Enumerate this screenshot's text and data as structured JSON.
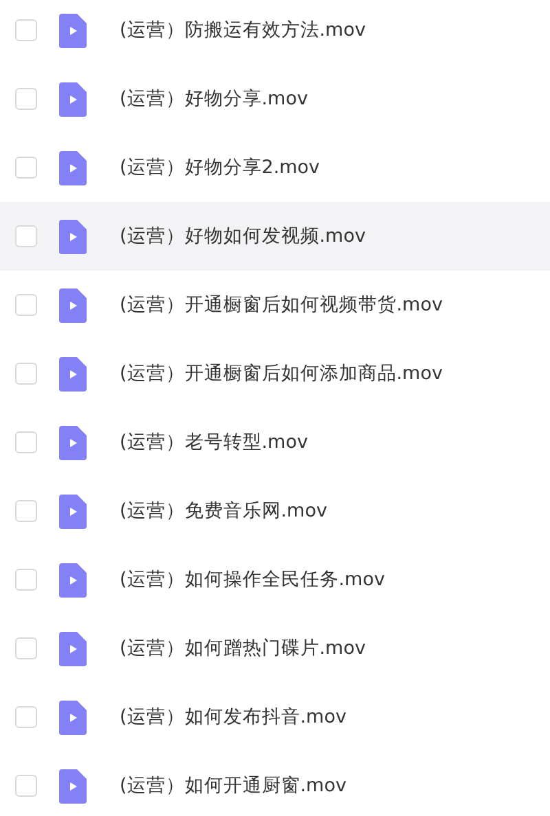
{
  "files": [
    {
      "name": "(运营）防搬运有效方法.mov",
      "checked": false,
      "highlighted": false
    },
    {
      "name": "(运营）好物分享.mov",
      "checked": false,
      "highlighted": false
    },
    {
      "name": "(运营）好物分享2.mov",
      "checked": false,
      "highlighted": false
    },
    {
      "name": "(运营）好物如何发视频.mov",
      "checked": false,
      "highlighted": true
    },
    {
      "name": "(运营）开通橱窗后如何视频带货.mov",
      "checked": false,
      "highlighted": false
    },
    {
      "name": "(运营）开通橱窗后如何添加商品.mov",
      "checked": false,
      "highlighted": false
    },
    {
      "name": "(运营）老号转型.mov",
      "checked": false,
      "highlighted": false
    },
    {
      "name": "(运营）免费音乐网.mov",
      "checked": false,
      "highlighted": false
    },
    {
      "name": "(运营）如何操作全民任务.mov",
      "checked": false,
      "highlighted": false
    },
    {
      "name": "(运营）如何蹭热门碟片.mov",
      "checked": false,
      "highlighted": false
    },
    {
      "name": "(运营）如何发布抖音.mov",
      "checked": false,
      "highlighted": false
    },
    {
      "name": "(运营）如何开通厨窗.mov",
      "checked": false,
      "highlighted": false
    }
  ]
}
